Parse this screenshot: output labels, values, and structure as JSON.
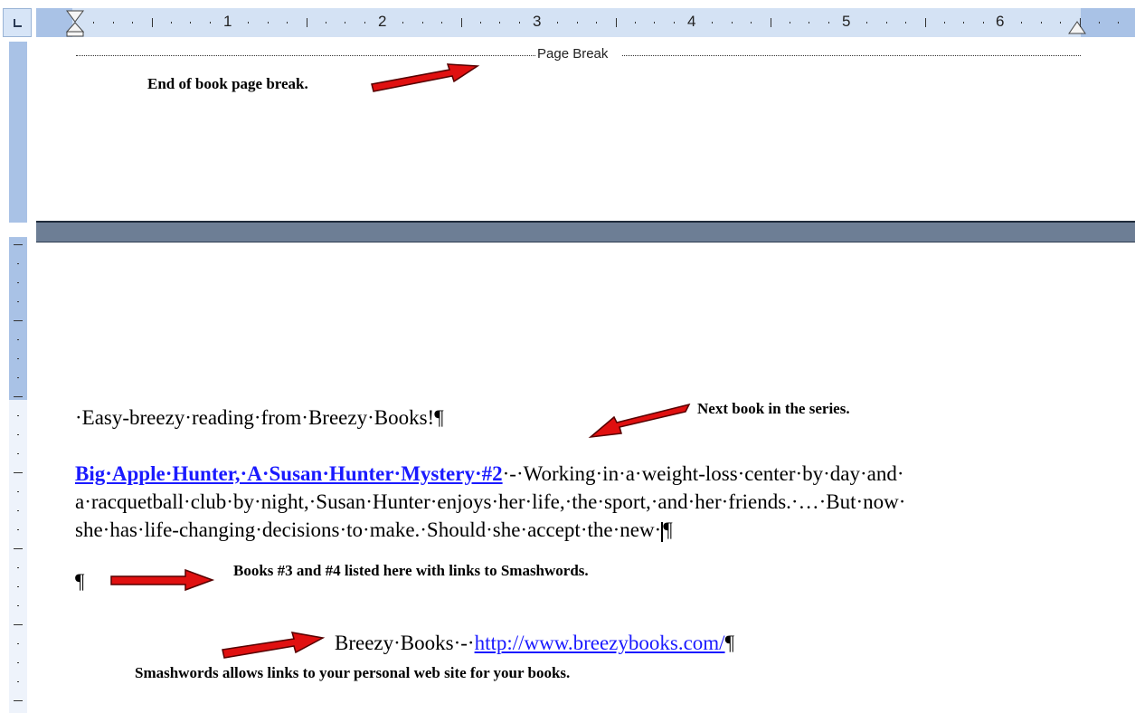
{
  "ruler": {
    "numbers": [
      "1",
      "2",
      "3",
      "4",
      "5",
      "6"
    ]
  },
  "page_break": {
    "label": "Page Break"
  },
  "annotations": {
    "end_of_book": "End of book page break.",
    "next_book": "Next book in the series.",
    "books_3_4": "Books #3 and #4 listed here with links to Smashwords.",
    "smashwords_links": "Smashwords allows links to your personal web site for your books."
  },
  "document": {
    "tagline": "·Easy-breezy·reading·from·Breezy·Books!¶",
    "book_link": "Big·Apple·Hunter,·A·Susan·Hunter·Mystery·#2",
    "book_desc_line1": "·-·Working·in·a·weight-loss·center·by·day·and·",
    "book_desc_line2": "a·racquetball·club·by·night,·Susan·Hunter·enjoys·her·life,·the·sport,·and·her·friends.·…·But·now·",
    "book_desc_line3": "she·has·life-changing·decisions·to·make.·Should·she·accept·the·new·",
    "para_mark_end": "¶",
    "empty_para": "¶",
    "footer_prefix": "Breezy·Books·-·",
    "footer_url": "http://www.breezybooks.com/",
    "footer_para": "¶"
  },
  "colors": {
    "link": "#1a1aff",
    "arrow_fill": "#e01010",
    "ruler_band": "#d4e2f4"
  }
}
